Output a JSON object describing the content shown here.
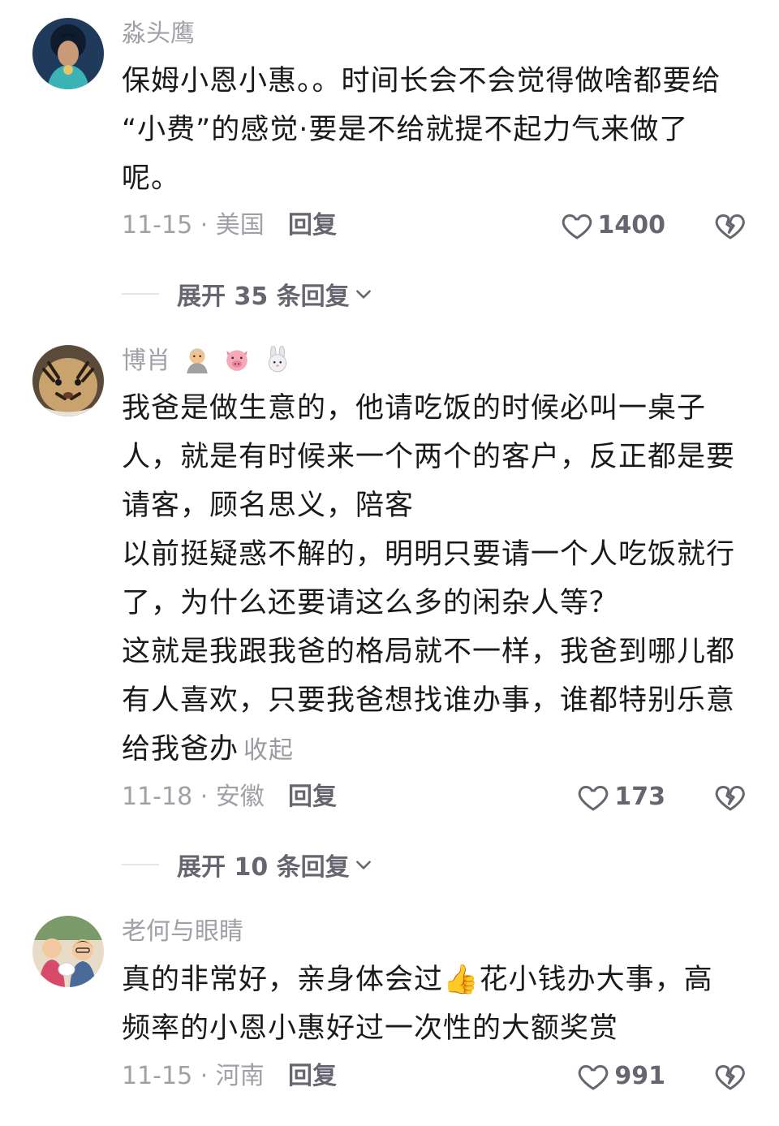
{
  "comments": [
    {
      "username": "淼头鹰",
      "lines": [
        "保姆小恩小惠。。时间长会不会觉得做啥都要给",
        "“小费”的感觉·要是不给就提不起力气来做了",
        "呢。"
      ],
      "date_location": "11-15 · 美国",
      "reply_label": "回复",
      "likes": "1400",
      "expand_label": "展开 35 条回复"
    },
    {
      "username": "博肖",
      "badges": [
        "person-emoji-icon",
        "pig-emoji-icon",
        "rabbit-emoji-icon"
      ],
      "lines": [
        "我爸是做生意的，他请吃饭的时候必叫一桌子",
        "人，就是有时候来一个两个的客户，反正都是要",
        "请客，顾名思义，陪客",
        "以前挺疑惑不解的，明明只要请一个人吃饭就行",
        "了，为什么还要请这么多的闲杂人等？",
        "这就是我跟我爸的格局就不一样，我爸到哪儿都",
        "有人喜欢，只要我爸想找谁办事，谁都特别乐意",
        "给我爸办"
      ],
      "collapse_label": "收起",
      "date_location": "11-18 · 安徽",
      "reply_label": "回复",
      "likes": "173",
      "expand_label": "展开 10 条回复"
    },
    {
      "username": "老何与眼睛",
      "lines": [
        "真的非常好，亲身体会过👍花小钱办大事，高",
        "频率的小恩小惠好过一次性的大额奖赏"
      ],
      "date_location": "11-15 · 河南",
      "reply_label": "回复",
      "likes": "991"
    }
  ],
  "colors": {
    "text": "#1a1a1a",
    "meta": "#a0a0a6",
    "action": "#666670"
  }
}
